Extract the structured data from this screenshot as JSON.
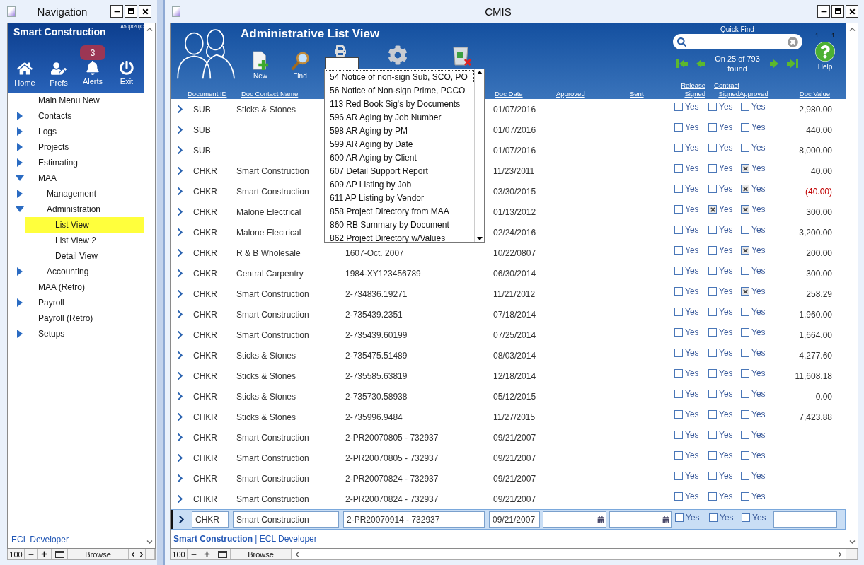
{
  "nav_window": {
    "title": "Navigation",
    "company": "Smart Construction",
    "corner_code": "A50|820|C",
    "buttons": [
      {
        "kind": "home",
        "label": "Home"
      },
      {
        "kind": "prefs",
        "label": "Prefs"
      },
      {
        "kind": "alerts",
        "label": "Alerts",
        "badge": "3"
      },
      {
        "kind": "exit",
        "label": "Exit"
      }
    ],
    "tree": [
      {
        "label": "Main Menu New",
        "selected": false
      },
      {
        "label": "Contacts",
        "expanded": false,
        "selected": false
      },
      {
        "label": "Logs",
        "expanded": false,
        "selected": false
      },
      {
        "label": "Projects",
        "expanded": false,
        "selected": false
      },
      {
        "label": "Estimating",
        "expanded": false,
        "selected": false
      },
      {
        "label": "MAA",
        "expanded": true,
        "selected": false,
        "children": [
          {
            "label": "Management",
            "expanded": false,
            "selected": false
          },
          {
            "label": "Administration",
            "expanded": true,
            "selected": false,
            "children": [
              {
                "label": "List View",
                "selected": true
              },
              {
                "label": "List View 2",
                "selected": false
              },
              {
                "label": "Detail View",
                "selected": false
              }
            ]
          },
          {
            "label": "Accounting",
            "expanded": false,
            "selected": false
          }
        ]
      },
      {
        "label": "MAA (Retro)",
        "selected": false
      },
      {
        "label": "Payroll",
        "expanded": false,
        "selected": false
      },
      {
        "label": "Payroll (Retro)",
        "selected": false
      },
      {
        "label": "Setups",
        "expanded": false,
        "selected": false
      }
    ],
    "footer": "ECL Developer",
    "status_bar": {
      "zoom": "100",
      "mode": "Browse"
    }
  },
  "main_window": {
    "title": "CMIS",
    "header": {
      "title": "Administrative List View",
      "toolbar": [
        {
          "kind": "new",
          "label": "New"
        },
        {
          "kind": "find",
          "label": "Find"
        },
        {
          "kind": "report"
        },
        {
          "kind": "scripts"
        },
        {
          "kind": "delete"
        }
      ],
      "quick_find_label": "Quick Find",
      "counters": [
        "1",
        "1"
      ],
      "record_status": "On 25 of 793 found",
      "help": "Help"
    },
    "columns": [
      {
        "label": "Document ID"
      },
      {
        "label": "Doc Contact Name"
      },
      {
        "label": "Doc Date"
      },
      {
        "label": "Approved"
      },
      {
        "label": "Sent"
      },
      {
        "label": "Release Signed"
      },
      {
        "label": "Contract Signed"
      },
      {
        "label": "Approved"
      },
      {
        "label": "Doc Value"
      }
    ],
    "report_menu": [
      {
        "label": "54 Notice of non-sign Sub, SCO, PO",
        "selected": true
      },
      {
        "label": "56 Notice of Non-sign Prime, PCCO",
        "selected": false
      },
      {
        "label": "113 Red Book Sig's by Documents",
        "selected": false
      },
      {
        "label": "596 AR Aging by Job Number",
        "selected": false
      },
      {
        "label": "598 AR Aging by PM",
        "selected": false
      },
      {
        "label": "599 AR Aging by Date",
        "selected": false
      },
      {
        "label": "600 AR Aging by Client",
        "selected": false
      },
      {
        "label": "607 Detail Support Report",
        "selected": false
      },
      {
        "label": "609 AP Listing by Job",
        "selected": false
      },
      {
        "label": "611 AP Listing by Vendor",
        "selected": false
      },
      {
        "label": "858 Project Directory from MAA",
        "selected": false
      },
      {
        "label": "860 RB Summary by Document",
        "selected": false
      },
      {
        "label": "862 Project Directory w/Values",
        "selected": false
      }
    ],
    "rows": [
      {
        "type": "SUB",
        "contact": "Sticks & Stones",
        "date": "01/07/2016",
        "checks": [
          {
            "label": "Yes",
            "checked": false
          },
          {
            "label": "Yes",
            "checked": false
          },
          {
            "label": "Yes",
            "checked": false
          }
        ],
        "value": "2,980.00",
        "negative": false,
        "selected": false
      },
      {
        "type": "SUB",
        "date": "01/07/2016",
        "checks": [
          {
            "label": "Yes",
            "checked": false
          },
          {
            "label": "Yes",
            "checked": false
          },
          {
            "label": "Yes",
            "checked": false
          }
        ],
        "value": "440.00",
        "negative": false,
        "selected": false
      },
      {
        "type": "SUB",
        "date": "01/07/2016",
        "checks": [
          {
            "label": "Yes",
            "checked": false
          },
          {
            "label": "Yes",
            "checked": false
          },
          {
            "label": "Yes",
            "checked": false
          }
        ],
        "value": "8,000.00",
        "negative": false,
        "selected": false
      },
      {
        "type": "CHKR",
        "contact": "Smart Construction",
        "date": "11/23/2011",
        "checks": [
          {
            "label": "Yes",
            "checked": false
          },
          {
            "label": "Yes",
            "checked": false
          },
          {
            "label": "Yes",
            "checked": true
          }
        ],
        "value": "40.00",
        "negative": false,
        "selected": false
      },
      {
        "type": "CHKR",
        "contact": "Smart Construction",
        "date": "03/30/2015",
        "checks": [
          {
            "label": "Yes",
            "checked": false
          },
          {
            "label": "Yes",
            "checked": false
          },
          {
            "label": "Yes",
            "checked": true
          }
        ],
        "value": "(40.00)",
        "negative": true,
        "selected": false
      },
      {
        "type": "CHKR",
        "contact": "Malone Electrical",
        "date": "01/13/2012",
        "checks": [
          {
            "label": "Yes",
            "checked": false
          },
          {
            "label": "Yes",
            "checked": true
          },
          {
            "label": "Yes",
            "checked": true
          }
        ],
        "value": "300.00",
        "negative": false,
        "selected": false
      },
      {
        "type": "CHKR",
        "contact": "Malone Electrical",
        "date": "02/24/2016",
        "checks": [
          {
            "label": "Yes",
            "checked": false
          },
          {
            "label": "Yes",
            "checked": false
          },
          {
            "label": "Yes",
            "checked": false
          }
        ],
        "value": "3,200.00",
        "negative": false,
        "selected": false
      },
      {
        "type": "CHKR",
        "contact": "R & B Wholesale",
        "doc_number": "1607-Oct. 2007",
        "date": "10/22/0807",
        "checks": [
          {
            "label": "Yes",
            "checked": false
          },
          {
            "label": "Yes",
            "checked": false
          },
          {
            "label": "Yes",
            "checked": true
          }
        ],
        "value": "200.00",
        "negative": false,
        "selected": false
      },
      {
        "type": "CHKR",
        "contact": "Central Carpentry",
        "doc_number": "1984-XY123456789",
        "date": "06/30/2014",
        "checks": [
          {
            "label": "Yes",
            "checked": false
          },
          {
            "label": "Yes",
            "checked": false
          },
          {
            "label": "Yes",
            "checked": false
          }
        ],
        "value": "300.00",
        "negative": false,
        "selected": false
      },
      {
        "type": "CHKR",
        "contact": "Smart Construction",
        "doc_number": "2-734836.19271",
        "date": "11/21/2012",
        "checks": [
          {
            "label": "Yes",
            "checked": false
          },
          {
            "label": "Yes",
            "checked": false
          },
          {
            "label": "Yes",
            "checked": true
          }
        ],
        "value": "258.29",
        "negative": false,
        "selected": false
      },
      {
        "type": "CHKR",
        "contact": "Smart Construction",
        "doc_number": "2-735439.2351",
        "date": "07/18/2014",
        "checks": [
          {
            "label": "Yes",
            "checked": false
          },
          {
            "label": "Yes",
            "checked": false
          },
          {
            "label": "Yes",
            "checked": false
          }
        ],
        "value": "1,960.00",
        "negative": false,
        "selected": false
      },
      {
        "type": "CHKR",
        "contact": "Smart Construction",
        "doc_number": "2-735439.60199",
        "date": "07/25/2014",
        "checks": [
          {
            "label": "Yes",
            "checked": false
          },
          {
            "label": "Yes",
            "checked": false
          },
          {
            "label": "Yes",
            "checked": false
          }
        ],
        "value": "1,664.00",
        "negative": false,
        "selected": false
      },
      {
        "type": "CHKR",
        "contact": "Sticks & Stones",
        "doc_number": "2-735475.51489",
        "date": "08/03/2014",
        "checks": [
          {
            "label": "Yes",
            "checked": false
          },
          {
            "label": "Yes",
            "checked": false
          },
          {
            "label": "Yes",
            "checked": false
          }
        ],
        "value": "4,277.60",
        "negative": false,
        "selected": false
      },
      {
        "type": "CHKR",
        "contact": "Sticks & Stones",
        "doc_number": "2-735585.63819",
        "date": "12/18/2014",
        "checks": [
          {
            "label": "Yes",
            "checked": false
          },
          {
            "label": "Yes",
            "checked": false
          },
          {
            "label": "Yes",
            "checked": false
          }
        ],
        "value": "11,608.18",
        "negative": false,
        "selected": false
      },
      {
        "type": "CHKR",
        "contact": "Sticks & Stones",
        "doc_number": "2-735730.58938",
        "date": "05/12/2015",
        "checks": [
          {
            "label": "Yes",
            "checked": false
          },
          {
            "label": "Yes",
            "checked": false
          },
          {
            "label": "Yes",
            "checked": false
          }
        ],
        "value": "0.00",
        "negative": false,
        "selected": false
      },
      {
        "type": "CHKR",
        "contact": "Sticks & Stones",
        "doc_number": "2-735996.9484",
        "date": "11/27/2015",
        "checks": [
          {
            "label": "Yes",
            "checked": false
          },
          {
            "label": "Yes",
            "checked": false
          },
          {
            "label": "Yes",
            "checked": false
          }
        ],
        "value": "7,423.88",
        "negative": false,
        "selected": false
      },
      {
        "type": "CHKR",
        "contact": "Smart Construction",
        "doc_number": "2-PR20070805 - 732937",
        "date": "09/21/2007",
        "checks": [
          {
            "label": "Yes",
            "checked": false
          },
          {
            "label": "Yes",
            "checked": false
          },
          {
            "label": "Yes",
            "checked": false
          }
        ],
        "selected": false
      },
      {
        "type": "CHKR",
        "contact": "Smart Construction",
        "doc_number": "2-PR20070805 - 732937",
        "date": "09/21/2007",
        "checks": [
          {
            "label": "Yes",
            "checked": false
          },
          {
            "label": "Yes",
            "checked": false
          },
          {
            "label": "Yes",
            "checked": false
          }
        ],
        "selected": false
      },
      {
        "type": "CHKR",
        "contact": "Smart Construction",
        "doc_number": "2-PR20070824 - 732937",
        "date": "09/21/2007",
        "checks": [
          {
            "label": "Yes",
            "checked": false
          },
          {
            "label": "Yes",
            "checked": false
          },
          {
            "label": "Yes",
            "checked": false
          }
        ],
        "selected": false
      },
      {
        "type": "CHKR",
        "contact": "Smart Construction",
        "doc_number": "2-PR20070824 - 732937",
        "date": "09/21/2007",
        "checks": [
          {
            "label": "Yes",
            "checked": false
          },
          {
            "label": "Yes",
            "checked": false
          },
          {
            "label": "Yes",
            "checked": false
          }
        ],
        "selected": false
      },
      {
        "type": "CHKR",
        "contact": "Smart Construction",
        "doc_number": "2-PR20070914 - 732937",
        "date": "09/21/2007",
        "checks": [
          {
            "label": "Yes",
            "checked": false
          },
          {
            "label": "Yes",
            "checked": false
          },
          {
            "label": "Yes",
            "checked": false
          }
        ],
        "selected": true
      }
    ],
    "footer": "**Smart Construction** | ECL Developer",
    "status_bar": {
      "zoom": "100",
      "mode": "Browse"
    }
  }
}
